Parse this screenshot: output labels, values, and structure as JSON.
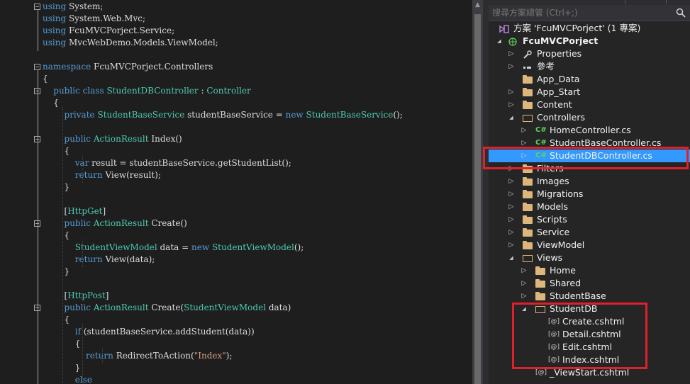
{
  "editor": {
    "code": [
      {
        "segs": [
          [
            "k",
            "using"
          ],
          [
            "p",
            " System;"
          ]
        ]
      },
      {
        "segs": [
          [
            "k",
            "using"
          ],
          [
            "p",
            " System.Web.Mvc;"
          ]
        ]
      },
      {
        "segs": [
          [
            "k",
            "using"
          ],
          [
            "p",
            " FcuMVCPorject.Service;"
          ]
        ]
      },
      {
        "segs": [
          [
            "k",
            "using"
          ],
          [
            "p",
            " MvcWebDemo.Models.ViewModel;"
          ]
        ]
      },
      {
        "segs": []
      },
      {
        "segs": [
          [
            "k",
            "namespace"
          ],
          [
            "p",
            " FcuMVCPorject.Controllers"
          ]
        ]
      },
      {
        "segs": [
          [
            "p",
            "{"
          ]
        ]
      },
      {
        "segs": [
          [
            "p",
            "    "
          ],
          [
            "k",
            "public class"
          ],
          [
            "p",
            " "
          ],
          [
            "t",
            "StudentDBController"
          ],
          [
            "p",
            " : "
          ],
          [
            "t",
            "Controller"
          ]
        ]
      },
      {
        "segs": [
          [
            "p",
            "    {"
          ]
        ]
      },
      {
        "segs": [
          [
            "p",
            "        "
          ],
          [
            "k",
            "private"
          ],
          [
            "p",
            " "
          ],
          [
            "t",
            "StudentBaseService"
          ],
          [
            "p",
            " studentBaseService = "
          ],
          [
            "k",
            "new"
          ],
          [
            "p",
            " "
          ],
          [
            "t",
            "StudentBaseService"
          ],
          [
            "p",
            "();"
          ]
        ]
      },
      {
        "segs": []
      },
      {
        "segs": [
          [
            "p",
            "        "
          ],
          [
            "k",
            "public"
          ],
          [
            "p",
            " "
          ],
          [
            "t",
            "ActionResult"
          ],
          [
            "p",
            " Index()"
          ]
        ]
      },
      {
        "segs": [
          [
            "p",
            "        {"
          ]
        ]
      },
      {
        "segs": [
          [
            "p",
            "            "
          ],
          [
            "k",
            "var"
          ],
          [
            "p",
            " result = studentBaseService.getStudentList();"
          ]
        ]
      },
      {
        "segs": [
          [
            "p",
            "            "
          ],
          [
            "k",
            "return"
          ],
          [
            "p",
            " View(result);"
          ]
        ]
      },
      {
        "segs": [
          [
            "p",
            "        }"
          ]
        ]
      },
      {
        "segs": []
      },
      {
        "segs": [
          [
            "p",
            "        ["
          ],
          [
            "a",
            "HttpGet"
          ],
          [
            "p",
            "]"
          ]
        ]
      },
      {
        "segs": [
          [
            "p",
            "        "
          ],
          [
            "k",
            "public"
          ],
          [
            "p",
            " "
          ],
          [
            "t",
            "ActionResult"
          ],
          [
            "p",
            " Create()"
          ]
        ]
      },
      {
        "segs": [
          [
            "p",
            "        {"
          ]
        ]
      },
      {
        "segs": [
          [
            "p",
            "            "
          ],
          [
            "t",
            "StudentViewModel"
          ],
          [
            "p",
            " data = "
          ],
          [
            "k",
            "new"
          ],
          [
            "p",
            " "
          ],
          [
            "t",
            "StudentViewModel"
          ],
          [
            "p",
            "();"
          ]
        ]
      },
      {
        "segs": [
          [
            "p",
            "            "
          ],
          [
            "k",
            "return"
          ],
          [
            "p",
            " View(data);"
          ]
        ]
      },
      {
        "segs": [
          [
            "p",
            "        }"
          ]
        ]
      },
      {
        "segs": []
      },
      {
        "segs": [
          [
            "p",
            "        ["
          ],
          [
            "a",
            "HttpPost"
          ],
          [
            "p",
            "]"
          ]
        ]
      },
      {
        "segs": [
          [
            "p",
            "        "
          ],
          [
            "k",
            "public"
          ],
          [
            "p",
            " "
          ],
          [
            "t",
            "ActionResult"
          ],
          [
            "p",
            " Create("
          ],
          [
            "t",
            "StudentViewModel"
          ],
          [
            "p",
            " data)"
          ]
        ]
      },
      {
        "segs": [
          [
            "p",
            "        {"
          ]
        ]
      },
      {
        "segs": [
          [
            "p",
            "            "
          ],
          [
            "k",
            "if"
          ],
          [
            "p",
            " (studentBaseService.addStudent(data))"
          ]
        ]
      },
      {
        "segs": [
          [
            "p",
            "            {"
          ]
        ]
      },
      {
        "segs": [
          [
            "p",
            "                "
          ],
          [
            "k",
            "return"
          ],
          [
            "p",
            " RedirectToAction("
          ],
          [
            "s",
            "\"Index\""
          ],
          [
            "p",
            ");"
          ]
        ]
      },
      {
        "segs": [
          [
            "p",
            "            }"
          ]
        ]
      },
      {
        "segs": [
          [
            "p",
            "            "
          ],
          [
            "k",
            "else"
          ]
        ]
      }
    ]
  },
  "solution_explorer": {
    "search_placeholder": "搜尋方案總管 (Ctrl+;)",
    "items": [
      {
        "label": "方案 'FcuMVCPorject' (1 專案)",
        "indent": 0,
        "arrow": "",
        "icon": "solution-icon",
        "bold": false
      },
      {
        "label": "FcuMVCPorject",
        "indent": 0,
        "arrow": "expanded",
        "icon": "web-project-icon",
        "bold": true
      },
      {
        "label": "Properties",
        "indent": 1,
        "arrow": "collapsed",
        "icon": "wrench-icon"
      },
      {
        "label": "參考",
        "indent": 1,
        "arrow": "collapsed",
        "icon": "references-icon"
      },
      {
        "label": "App_Data",
        "indent": 1,
        "arrow": "",
        "icon": "folder-icon"
      },
      {
        "label": "App_Start",
        "indent": 1,
        "arrow": "collapsed",
        "icon": "folder-icon"
      },
      {
        "label": "Content",
        "indent": 1,
        "arrow": "collapsed",
        "icon": "folder-icon"
      },
      {
        "label": "Controllers",
        "indent": 1,
        "arrow": "expanded",
        "icon": "folder-open-icon"
      },
      {
        "label": "HomeController.cs",
        "indent": 2,
        "arrow": "collapsed",
        "icon": "csharp-file-icon"
      },
      {
        "label": "StudentBaseController.cs",
        "indent": 2,
        "arrow": "collapsed",
        "icon": "csharp-file-icon"
      },
      {
        "label": "StudentDBController.cs",
        "indent": 2,
        "arrow": "collapsed",
        "icon": "csharp-file-icon",
        "selected": true
      },
      {
        "label": "Filters",
        "indent": 1,
        "arrow": "collapsed",
        "icon": "folder-icon"
      },
      {
        "label": "Images",
        "indent": 1,
        "arrow": "collapsed",
        "icon": "folder-icon"
      },
      {
        "label": "Migrations",
        "indent": 1,
        "arrow": "collapsed",
        "icon": "folder-icon"
      },
      {
        "label": "Models",
        "indent": 1,
        "arrow": "collapsed",
        "icon": "folder-icon"
      },
      {
        "label": "Scripts",
        "indent": 1,
        "arrow": "collapsed",
        "icon": "folder-icon"
      },
      {
        "label": "Service",
        "indent": 1,
        "arrow": "collapsed",
        "icon": "folder-icon"
      },
      {
        "label": "ViewModel",
        "indent": 1,
        "arrow": "collapsed",
        "icon": "folder-icon"
      },
      {
        "label": "Views",
        "indent": 1,
        "arrow": "expanded",
        "icon": "folder-open-icon"
      },
      {
        "label": "Home",
        "indent": 2,
        "arrow": "collapsed",
        "icon": "folder-icon"
      },
      {
        "label": "Shared",
        "indent": 2,
        "arrow": "collapsed",
        "icon": "folder-icon"
      },
      {
        "label": "StudentBase",
        "indent": 2,
        "arrow": "collapsed",
        "icon": "folder-icon"
      },
      {
        "label": "StudentDB",
        "indent": 2,
        "arrow": "expanded",
        "icon": "folder-open-icon"
      },
      {
        "label": "Create.cshtml",
        "indent": 3,
        "arrow": "",
        "icon": "razor-file-icon"
      },
      {
        "label": "Detail.cshtml",
        "indent": 3,
        "arrow": "",
        "icon": "razor-file-icon"
      },
      {
        "label": "Edit.cshtml",
        "indent": 3,
        "arrow": "",
        "icon": "razor-file-icon"
      },
      {
        "label": "Index.cshtml",
        "indent": 3,
        "arrow": "",
        "icon": "razor-file-icon"
      },
      {
        "label": "_ViewStart.cshtml",
        "indent": 2,
        "arrow": "",
        "icon": "razor-file-icon"
      }
    ]
  },
  "colors": {
    "keyword": "#569cd6",
    "type": "#4ec9b0",
    "string": "#d69d85",
    "selection": "#3399ff",
    "highlight_box": "#e0202a",
    "folder": "#dcb67a",
    "csharp": "#61d35b"
  }
}
